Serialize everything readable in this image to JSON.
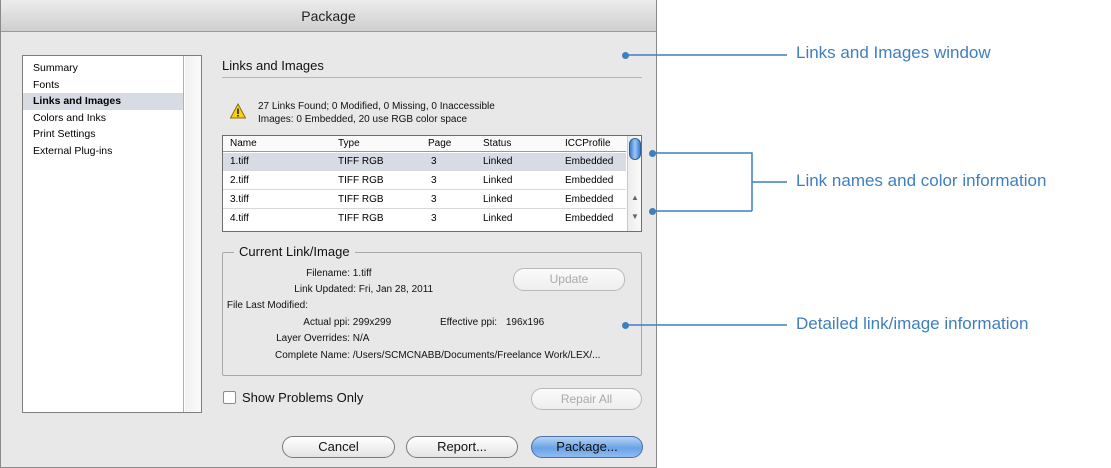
{
  "window": {
    "title": "Package"
  },
  "sidebar": {
    "items": [
      {
        "label": "Summary",
        "active": false
      },
      {
        "label": "Fonts",
        "active": false
      },
      {
        "label": "Links and Images",
        "active": true
      },
      {
        "label": "Colors and Inks",
        "active": false
      },
      {
        "label": "Print Settings",
        "active": false
      },
      {
        "label": "External Plug-ins",
        "active": false
      }
    ]
  },
  "main": {
    "section_title": "Links and Images",
    "warning": {
      "icon": "warning-icon",
      "line1": "27 Links Found; 0 Modified, 0 Missing, 0 Inaccessible",
      "line2": "Images: 0 Embedded, 20 use RGB color space"
    },
    "table": {
      "columns": [
        "Name",
        "Type",
        "Page",
        "Status",
        "ICCProfile"
      ],
      "rows": [
        {
          "name": "1.tiff",
          "type": "TIFF RGB",
          "page": "3",
          "status": "Linked",
          "icc": "Embedded",
          "selected": true
        },
        {
          "name": "2.tiff",
          "type": "TIFF RGB",
          "page": "3",
          "status": "Linked",
          "icc": "Embedded",
          "selected": false
        },
        {
          "name": "3.tiff",
          "type": "TIFF RGB",
          "page": "3",
          "status": "Linked",
          "icc": "Embedded",
          "selected": false
        },
        {
          "name": "4.tiff",
          "type": "TIFF RGB",
          "page": "3",
          "status": "Linked",
          "icc": "Embedded",
          "selected": false
        }
      ]
    },
    "current": {
      "legend": "Current Link/Image",
      "filename_label": "Filename:",
      "filename": "1.tiff",
      "link_updated_label": "Link Updated:",
      "link_updated": "Fri, Jan 28, 2011",
      "file_modified_label": "File Last Modified:",
      "actual_ppi_label": "Actual ppi:",
      "actual_ppi": "299x299",
      "effective_ppi_label": "Effective ppi:",
      "effective_ppi": "196x196",
      "layer_overrides_label": "Layer Overrides:",
      "layer_overrides": "N/A",
      "complete_name_label": "Complete Name:",
      "complete_name": "/Users/SCMCNABB/Documents/Freelance Work/LEX/...",
      "update_button": "Update"
    },
    "show_problems_label": "Show Problems Only",
    "repair_all_button": "Repair All"
  },
  "footer": {
    "cancel": "Cancel",
    "report": "Report...",
    "package": "Package..."
  },
  "callouts": {
    "links_window": "Links and Images window",
    "link_names": "Link names and color information",
    "detailed_info": "Detailed link/image information"
  },
  "colors": {
    "callout": "#3f7fbf",
    "selection": "#d6dbe4",
    "primary_button": "#6aa3e6"
  }
}
